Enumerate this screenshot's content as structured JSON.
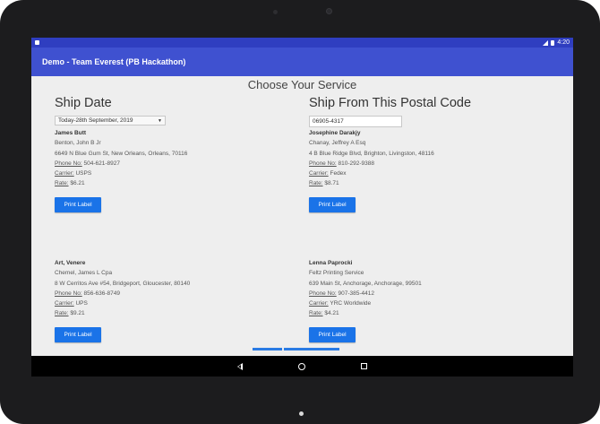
{
  "status_bar": {
    "time": "4:20"
  },
  "app_bar": {
    "title": "Demo - Team Everest (PB Hackathon)"
  },
  "page": {
    "title": "Choose Your Service"
  },
  "left_column": {
    "title": "Ship Date",
    "date_select": {
      "value": "Today-28th September, 2019"
    },
    "cards": [
      {
        "name": "James Butt",
        "company": "Benton, John B Jr",
        "address": "6649 N Blue Gum St, New Orleans, Orleans, 70116",
        "phone_label": "Phone No:",
        "phone": " 504-621-8927",
        "carrier_label": "Carrier:",
        "carrier": " USPS",
        "rate_label": "Rate:",
        "rate": " $6.21",
        "button": "Print Label"
      },
      {
        "name": "Art, Venere",
        "company": "Chemel, James L Cpa",
        "address": "8 W Cerritos Ave #54, Bridgeport, Gloucester, 80140",
        "phone_label": "Phone No:",
        "phone": " 856-636-8749",
        "carrier_label": "Carrier:",
        "carrier": " UPS",
        "rate_label": "Rate:",
        "rate": " $9.21",
        "button": "Print Label"
      }
    ]
  },
  "right_column": {
    "title": "Ship From This Postal Code",
    "postal_input": {
      "value": "06905-4317"
    },
    "cards": [
      {
        "name": "Josephine Darakjy",
        "company": "Chanay, Jeffrey A Esq",
        "address": "4 B Blue Ridge Blvd, Brighton, Livingston, 48116",
        "phone_label": "Phone No:",
        "phone": " 810-292-9388",
        "carrier_label": "Carrier:",
        "carrier": " Fedex",
        "rate_label": "Rate:",
        "rate": " $8.71",
        "button": "Print Label"
      },
      {
        "name": "Lenna Paprocki",
        "company": "Feltz Printing Service",
        "address": "639 Main St, Anchorage, Anchorage, 99501",
        "phone_label": "Phone No:",
        "phone": " 907-385-4412",
        "carrier_label": "Carrier:",
        "carrier": " YRC Worldwide",
        "rate_label": "Rate:",
        "rate": " $4.21",
        "button": "Print Label"
      }
    ]
  },
  "icons": {
    "nav_back": "back-triangle-icon",
    "nav_home": "home-circle-icon",
    "nav_recent": "recent-square-icon"
  },
  "colors": {
    "status_bar": "#2f3ec0",
    "app_bar": "#3f51d0",
    "button": "#1a73e8",
    "content_bg": "#eeeeee"
  }
}
